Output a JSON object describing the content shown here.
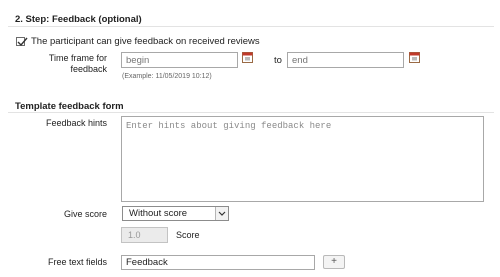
{
  "section": {
    "title": "2. Step: Feedback (optional)"
  },
  "participant_feedback": {
    "checked": true,
    "label": "The participant can give feedback on received reviews"
  },
  "time_frame": {
    "label_line1": "Time frame for",
    "label_line2": "feedback",
    "start_placeholder": "begin",
    "to_label": "to",
    "end_placeholder": "end",
    "example": "(Example: 11/05/2019 10:12)",
    "calendar_icon": "calendar-icon"
  },
  "template": {
    "title": "Template feedback form",
    "hints_label": "Feedback hints",
    "hints_placeholder": "Enter hints about giving feedback here",
    "give_score_label": "Give score",
    "give_score_value": "Without score",
    "score_value": "1.0",
    "score_label": "Score",
    "free_text_label": "Free text fields",
    "free_text_value": "Feedback",
    "add_button_label": "+"
  },
  "colors": {
    "calendar_accent": "#c0392b",
    "border": "#a8a8a8"
  }
}
